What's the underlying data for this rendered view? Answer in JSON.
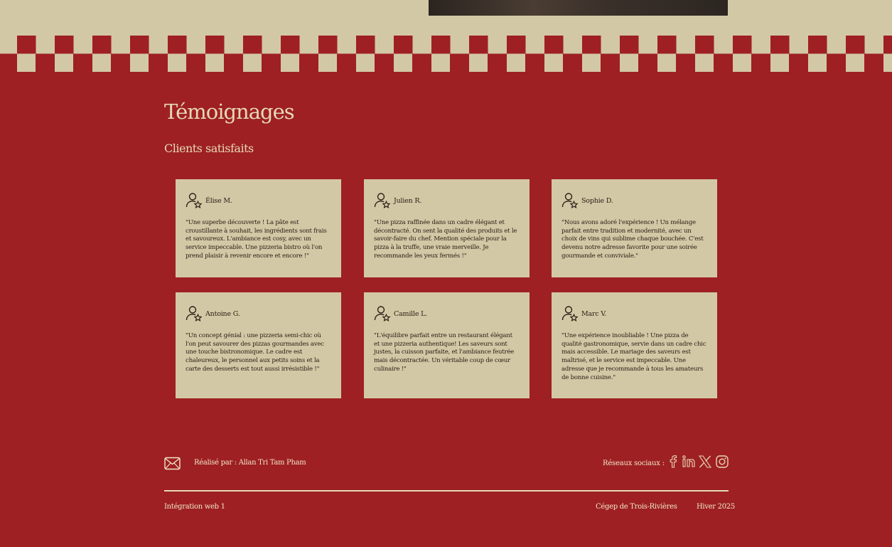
{
  "section": {
    "title": "Témoignages",
    "subtitle": "Clients satisfaits"
  },
  "testimonials": [
    {
      "name": "Élise M.",
      "text": "\"Une superbe découverte ! La pâte est croustillante à souhait, les ingrédients sont frais et savoureux. L'ambiance est cosy, avec un service impeccable. Une pizzeria bistro où l'on prend plaisir à revenir encore et encore !\"",
      "icon": "user-star-icon"
    },
    {
      "name": "Julien R.",
      "text": "\"Une pizza raffinée dans un cadre élégant et décontracté. On sent la qualité des produits et le savoir-faire du chef. Mention spéciale pour la pizza à la truffe, une vraie merveille. Je recommande les yeux fermés !\"",
      "icon": "user-star-icon"
    },
    {
      "name": "Sophie D.",
      "text": "\"Nous avons adoré l'expérience ! Un mélange parfait entre tradition et modernité, avec un choix de vins qui sublime chaque bouchée. C'est devenu notre adresse favorite pour une soirée gourmande et conviviale.\"",
      "icon": "user-star-icon"
    },
    {
      "name": "Antoine G.",
      "text": "\"Un concept génial : une pizzeria semi-chic où l'on peut savourer des pizzas gourmandes avec une touche bistronomique. Le cadre est chaleureux, le personnel aux petits soins et la carte des desserts est tout aussi irrésistible !\"",
      "icon": "user-star-icon"
    },
    {
      "name": "Camille L.",
      "text": "\"L'équilibre parfait entre un restaurant élégant et une pizzeria authentique! Les saveurs sont justes, la cuisson parfaite, et l'ambiance feutrée mais décontractée. Un véritable coup de cœur culinaire !\"",
      "icon": "user-star-icon"
    },
    {
      "name": "Marc V.",
      "text": "\"Une expérience inoubliable ! Une pizza de qualité gastronomique, servie dans un cadre chic mais accessible. Le mariage des saveurs est maîtrisé, et le service est impeccable. Une adresse que je recommande à tous les amateurs de bonne cuisine.\"",
      "icon": "user-star-icon"
    }
  ],
  "footer": {
    "credit": "Réalisé par : Allan Tri Tam Pham",
    "social_label": "Réseaux sociaux :",
    "social_icons": [
      "facebook-icon",
      "linkedin-icon",
      "x-icon",
      "instagram-icon"
    ],
    "course": "Intégration web 1",
    "school": "Cégep de Trois-Rivières",
    "session": "Hiver 2025"
  },
  "colors": {
    "background": "#9e2022",
    "cream": "#d3c8a5",
    "text_light": "#f1e6c9",
    "text_dark": "#2a2118"
  }
}
